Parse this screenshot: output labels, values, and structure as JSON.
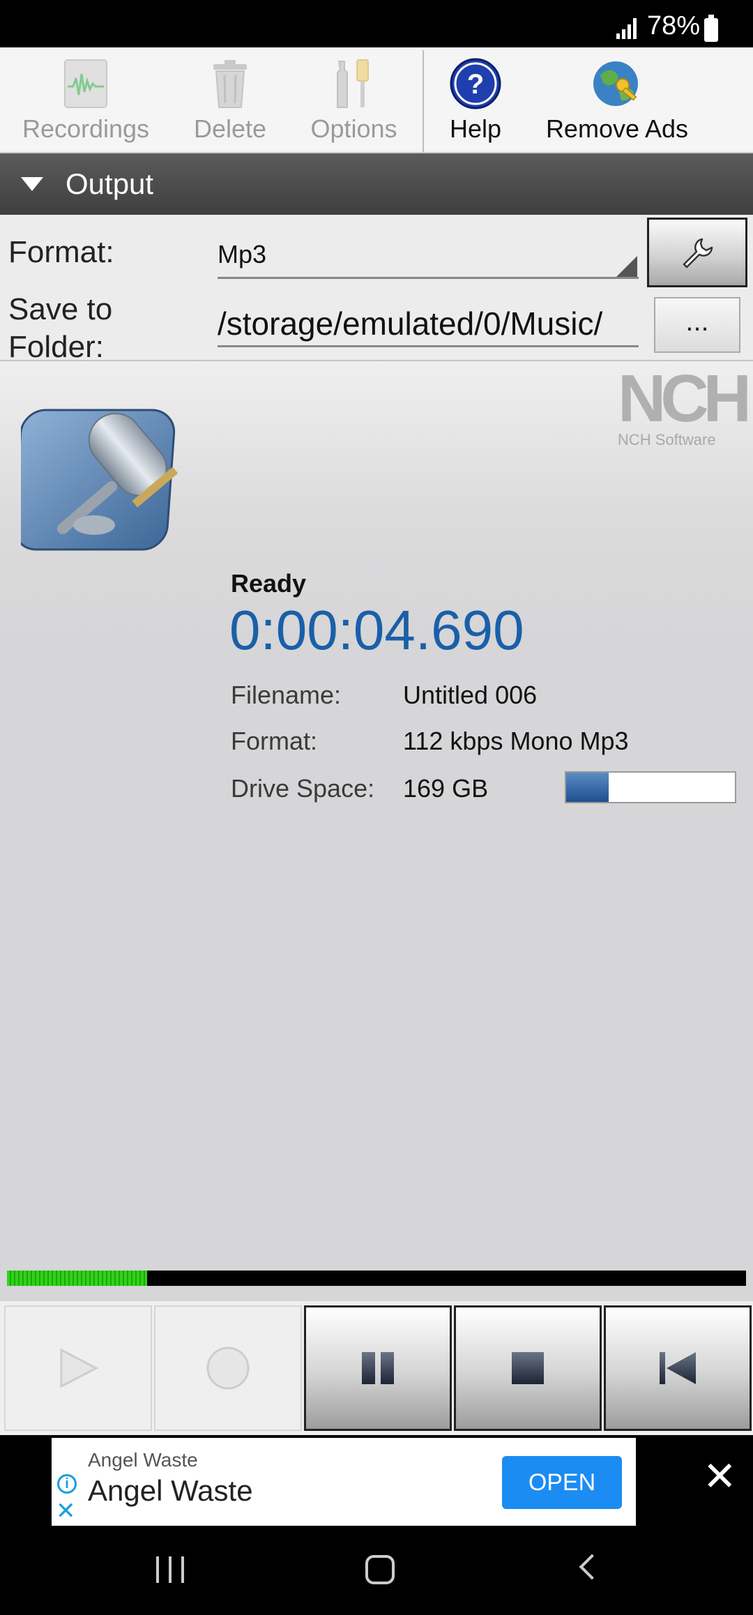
{
  "status_bar": {
    "battery": "78%"
  },
  "toolbar": {
    "recordings": "Recordings",
    "delete": "Delete",
    "options": "Options",
    "help": "Help",
    "remove_ads": "Remove Ads"
  },
  "output": {
    "title": "Output",
    "format_label": "Format:",
    "format_value": "Mp3",
    "folder_label_1": "Save to",
    "folder_label_2": "Folder:",
    "folder_value": "/storage/emulated/0/Music/",
    "browse_label": "..."
  },
  "brand": {
    "logo_big": "NCH",
    "logo_small": "NCH Software"
  },
  "recorder": {
    "status": "Ready",
    "timer": "0:00:04.690",
    "filename_label": "Filename:",
    "filename_value": "Untitled 006",
    "format_label": "Format:",
    "format_value": "112 kbps Mono Mp3",
    "drive_label": "Drive Space:",
    "drive_value": "169 GB",
    "drive_used_fraction": 0.25,
    "level_fraction": 0.19
  },
  "ad": {
    "advertiser": "Angel Waste",
    "headline": "Angel Waste",
    "cta": "OPEN",
    "info_glyph": "i",
    "close_glyph": "✕"
  },
  "colors": {
    "accent": "#1a5fa8",
    "meter_green": "#33d11a",
    "ad_button": "#1a8cf2"
  }
}
